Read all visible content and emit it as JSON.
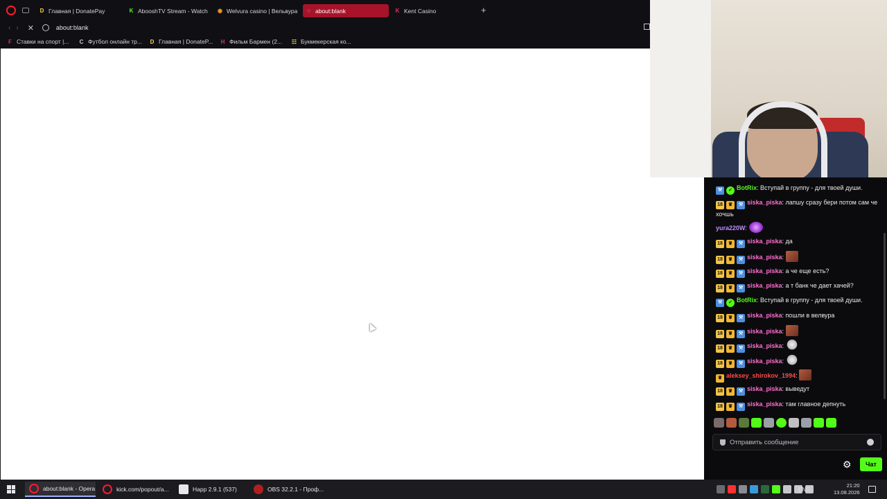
{
  "browser": {
    "tabs": [
      {
        "label": "Главная | DonatePay",
        "fav": "D",
        "fav_color": "#ffd54f"
      },
      {
        "label": "AbooshTV Stream - Watch",
        "fav": "K",
        "fav_color": "#53fc18"
      },
      {
        "label": "Welvura casino | Вельвура",
        "fav": "◉",
        "fav_color": "#f0a020"
      },
      {
        "label": "about:blank",
        "fav": "◌",
        "fav_color": "#ffffff"
      },
      {
        "label": "Kent Casino",
        "fav": "K",
        "fav_color": "#e0305a"
      }
    ],
    "new_tab": "+",
    "address": "about:blank",
    "bookmarks": [
      {
        "label": "Ставки на спорт |...",
        "fav": "F",
        "fav_color": "#e0303a"
      },
      {
        "label": "Футбол онлайн тр...",
        "fav": "C",
        "fav_color": "#cfcfcf"
      },
      {
        "label": "Главная | DonateP...",
        "fav": "D",
        "fav_color": "#ffd54f"
      },
      {
        "label": "Фильм Бармен (2...",
        "fav": "H",
        "fav_color": "#e0305a"
      },
      {
        "label": "Букмекерская ко...",
        "fav": "☷",
        "fav_color": "#f0d040"
      }
    ]
  },
  "chat": {
    "messages": [
      {
        "user": "BotRix",
        "color": "#53fc18",
        "badges": [
          "hammer",
          "check"
        ],
        "text": ": Вступай в группу - для твоей души."
      },
      {
        "user": "siska_piska",
        "color": "#ff6fd0",
        "badges": [
          "18",
          "crown",
          "hammer"
        ],
        "text": ": лапшу сразу бери потом сам че хочшь"
      },
      {
        "user": "yura220W",
        "color": "#c08cff",
        "badges": [],
        "text": ": ",
        "emote": "purple"
      },
      {
        "user": "siska_piska",
        "color": "#ff6fd0",
        "badges": [
          "18",
          "crown",
          "hammer"
        ],
        "text": ": да"
      },
      {
        "user": "siska_piska",
        "color": "#ff6fd0",
        "badges": [
          "18",
          "crown",
          "hammer"
        ],
        "text": ": ",
        "emote": "face"
      },
      {
        "user": "siska_piska",
        "color": "#ff6fd0",
        "badges": [
          "18",
          "crown",
          "hammer"
        ],
        "text": ": а че еще есть?"
      },
      {
        "user": "siska_piska",
        "color": "#ff6fd0",
        "badges": [
          "18",
          "crown",
          "hammer"
        ],
        "text": ": а т банк че дает хачей?"
      },
      {
        "user": "BotRix",
        "color": "#53fc18",
        "badges": [
          "hammer",
          "check"
        ],
        "text": ": Вступай в группу - для твоей души."
      },
      {
        "user": "siska_piska",
        "color": "#ff6fd0",
        "badges": [
          "18",
          "crown",
          "hammer"
        ],
        "text": ": пошли в велвура"
      },
      {
        "user": "siska_piska",
        "color": "#ff6fd0",
        "badges": [
          "18",
          "crown",
          "hammer"
        ],
        "text": ": ",
        "emote": "face"
      },
      {
        "user": "siska_piska",
        "color": "#ff6fd0",
        "badges": [
          "18",
          "crown",
          "hammer"
        ],
        "text": ": ",
        "emote": "ghost"
      },
      {
        "user": "siska_piska",
        "color": "#ff6fd0",
        "badges": [
          "18",
          "crown",
          "hammer"
        ],
        "text": ": ",
        "emote": "ghost"
      },
      {
        "user": "aleksey_shirokov_1994",
        "color": "#ff4a4a",
        "badges": [
          "crown"
        ],
        "text": ": ",
        "emote": "face"
      },
      {
        "user": "siska_piska",
        "color": "#ff6fd0",
        "badges": [
          "18",
          "crown",
          "hammer"
        ],
        "text": ": выведут"
      },
      {
        "user": "siska_piska",
        "color": "#ff6fd0",
        "badges": [
          "18",
          "crown",
          "hammer"
        ],
        "text": ": там главное депнуть"
      }
    ],
    "input_placeholder": "Отправить сообщение",
    "chat_button": "Чат"
  },
  "taskbar": {
    "items": [
      {
        "label": "about:blank - Opera",
        "icon_color": "#ff1b2d",
        "active": true
      },
      {
        "label": "kick.com/popout/a...",
        "icon_color": "#ff1b2d",
        "active": false
      },
      {
        "label": "Happ 2.9.1 (537)",
        "icon_color": "#e8e8ea",
        "active": false
      },
      {
        "label": "OBS 32.2.1 - Проф...",
        "icon_color": "#b02020",
        "active": false
      }
    ],
    "lang": "ENG",
    "time": "21:20",
    "date": "13.08.2026"
  }
}
